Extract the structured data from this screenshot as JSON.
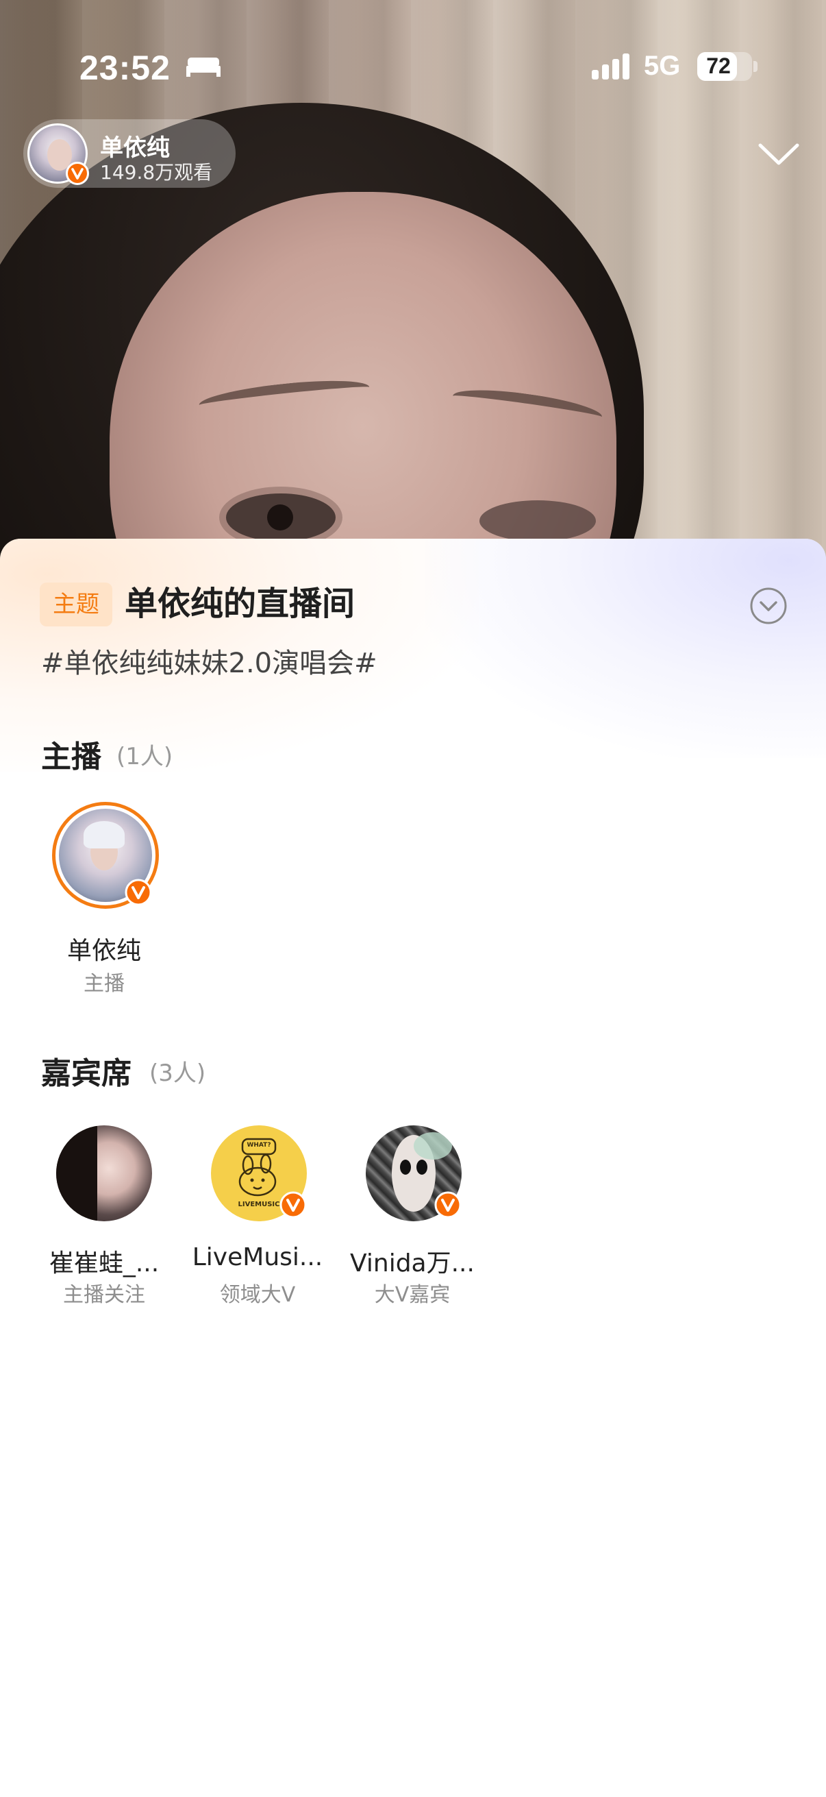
{
  "status_bar": {
    "time": "23:52",
    "network": "5G",
    "battery": "72",
    "battery_level": 0.72
  },
  "host_pill": {
    "name": "单依纯",
    "viewers": "149.8万观看"
  },
  "room": {
    "topic_tag": "主题",
    "title": "单依纯的直播间",
    "hashtag": "#单依纯纯妹妹2.0演唱会#"
  },
  "hosts_section": {
    "heading": "主播",
    "count": "(1人)",
    "members": [
      {
        "name": "单依纯",
        "role": "主播"
      }
    ]
  },
  "guests_section": {
    "heading": "嘉宾席",
    "count": "(3人)",
    "members": [
      {
        "name": "崔崔蛙_...",
        "role": "主播关注"
      },
      {
        "name": "LiveMusi...",
        "role": "领域大V",
        "avatar_text_top": "WHAT?",
        "avatar_text_bottom": "LIVEMUSIC"
      },
      {
        "name": "Vinida万...",
        "role": "大V嘉宾"
      }
    ]
  },
  "colors": {
    "accent_orange": "#f47c12",
    "verified_badge": "#f86b05",
    "tag_bg": "#ffe3c8"
  },
  "icons": [
    "bed-icon",
    "signal-icon",
    "verified-badge-icon",
    "chevron-down-icon",
    "expand-circle-icon"
  ]
}
